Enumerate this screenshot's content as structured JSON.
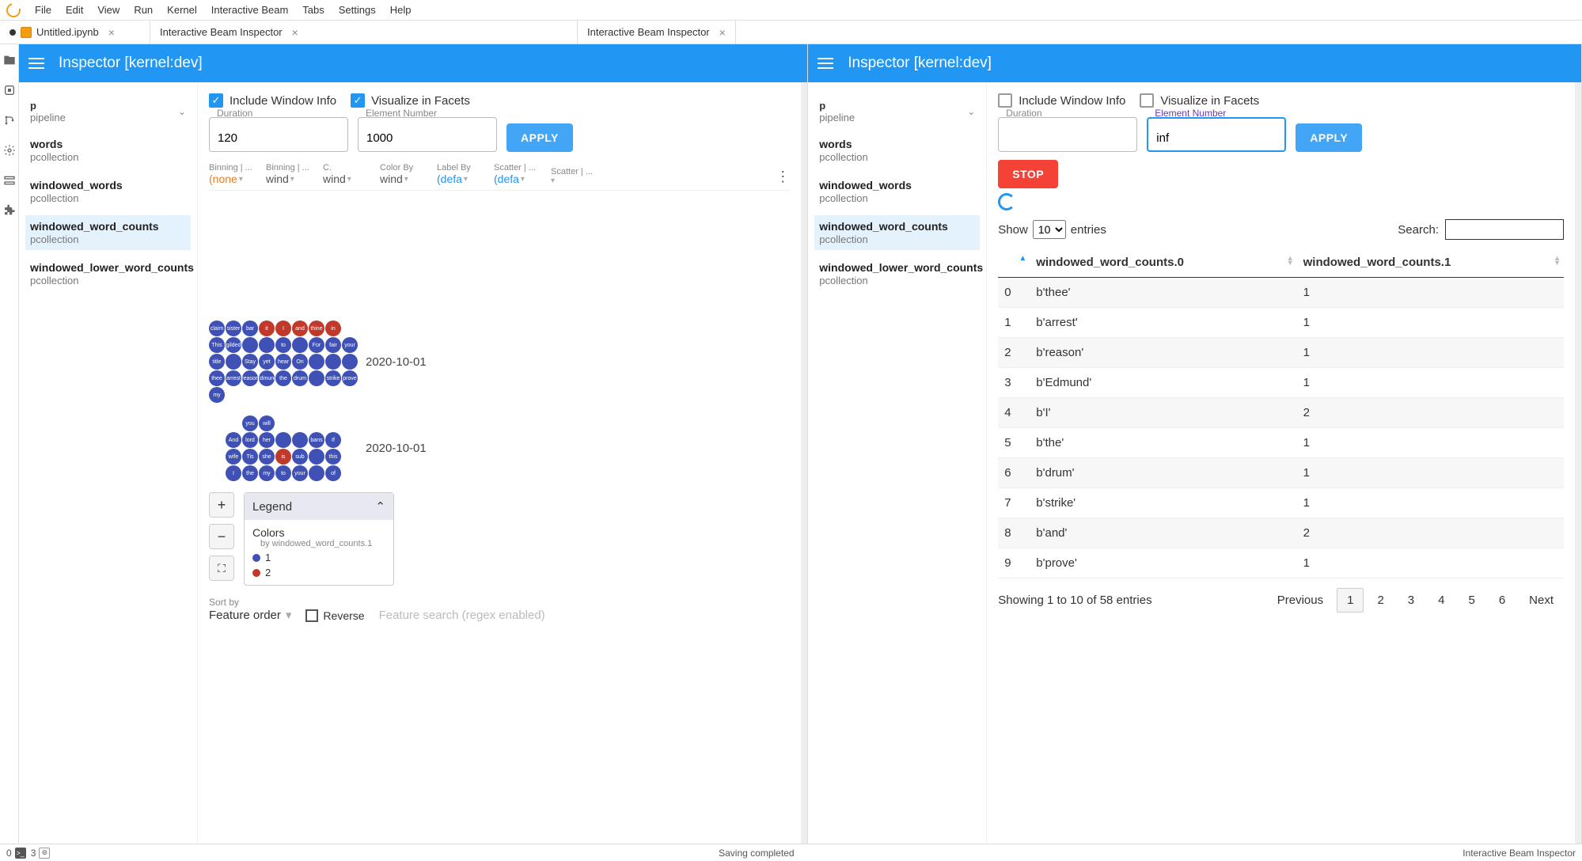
{
  "menubar": [
    "File",
    "Edit",
    "View",
    "Run",
    "Kernel",
    "Interactive Beam",
    "Tabs",
    "Settings",
    "Help"
  ],
  "tabs": [
    {
      "label": "Untitled.ipynb",
      "closable": true,
      "dirty": true,
      "icon": "notebook"
    },
    {
      "label": "Interactive Beam Inspector",
      "closable": true,
      "dirty": false
    },
    {
      "label": "Interactive Beam Inspector",
      "closable": true,
      "dirty": false
    }
  ],
  "inspector_title": "Inspector [kernel:dev]",
  "left": {
    "sidebar": {
      "p": {
        "name": "p",
        "type": "pipeline"
      },
      "items": [
        {
          "name": "words",
          "type": "pcollection",
          "selected": false
        },
        {
          "name": "windowed_words",
          "type": "pcollection",
          "selected": false
        },
        {
          "name": "windowed_word_counts",
          "type": "pcollection",
          "selected": true
        },
        {
          "name": "windowed_lower_word_counts",
          "type": "pcollection",
          "selected": false
        }
      ]
    },
    "checkboxes": {
      "include_window": "Include Window Info",
      "visualize_facets": "Visualize in Facets",
      "include_checked": true,
      "visualize_checked": true
    },
    "fields": {
      "duration_label": "Duration",
      "duration_value": "120",
      "element_label": "Element Number",
      "element_value": "1000"
    },
    "apply_label": "APPLY",
    "facets": [
      {
        "label": "Binning | ...",
        "value": "(none",
        "cls": "orange"
      },
      {
        "label": "Binning | ...",
        "value": "wind",
        "cls": ""
      },
      {
        "label": "C.",
        "value": "wind",
        "cls": ""
      },
      {
        "label": "Color By",
        "value": "wind",
        "cls": ""
      },
      {
        "label": "Label By",
        "value": "(defa",
        "cls": "blue"
      },
      {
        "label": "Scatter | ...",
        "value": "(defa",
        "cls": "blue"
      },
      {
        "label": "Scatter | ...",
        "value": "",
        "cls": ""
      }
    ],
    "cluster1_date": "2020-10-01",
    "cluster2_date": "2020-10-01",
    "cluster1": [
      {
        "t": "claim",
        "c": 1
      },
      {
        "t": "sister",
        "c": 1
      },
      {
        "t": "bar",
        "c": 1
      },
      {
        "t": "it",
        "c": 2
      },
      {
        "t": "I",
        "c": 2
      },
      {
        "t": "and",
        "c": 2
      },
      {
        "t": "thine",
        "c": 2
      },
      {
        "t": "in",
        "c": 2
      },
      {
        "t": "",
        "c": 0
      },
      {
        "t": "This",
        "c": 1
      },
      {
        "t": "gilded",
        "c": 1
      },
      {
        "t": "",
        "c": 1
      },
      {
        "t": "",
        "c": 1
      },
      {
        "t": "to",
        "c": 1
      },
      {
        "t": "",
        "c": 1
      },
      {
        "t": "For",
        "c": 1
      },
      {
        "t": "fair",
        "c": 1
      },
      {
        "t": "your",
        "c": 1
      },
      {
        "t": "title",
        "c": 1
      },
      {
        "t": "",
        "c": 1
      },
      {
        "t": "Stay",
        "c": 1
      },
      {
        "t": "yet",
        "c": 1
      },
      {
        "t": "hear",
        "c": 1
      },
      {
        "t": "On",
        "c": 1
      },
      {
        "t": "",
        "c": 1
      },
      {
        "t": "",
        "c": 1
      },
      {
        "t": "",
        "c": 1
      },
      {
        "t": "thee",
        "c": 1
      },
      {
        "t": "arrest",
        "c": 1
      },
      {
        "t": "reason",
        "c": 1
      },
      {
        "t": "Edmund",
        "c": 1
      },
      {
        "t": "the",
        "c": 1
      },
      {
        "t": "drum",
        "c": 1
      },
      {
        "t": "",
        "c": 1
      },
      {
        "t": "strike",
        "c": 1
      },
      {
        "t": "prove",
        "c": 1
      },
      {
        "t": "my",
        "c": 1
      }
    ],
    "cluster2": [
      {
        "t": "",
        "c": 0
      },
      {
        "t": "",
        "c": 0
      },
      {
        "t": "you",
        "c": 1
      },
      {
        "t": "will",
        "c": 1
      },
      {
        "t": "",
        "c": 0
      },
      {
        "t": "",
        "c": 0
      },
      {
        "t": "",
        "c": 0
      },
      {
        "t": "",
        "c": 0
      },
      {
        "t": "",
        "c": 0
      },
      {
        "t": "",
        "c": 0
      },
      {
        "t": "And",
        "c": 1
      },
      {
        "t": "lord",
        "c": 1
      },
      {
        "t": "her",
        "c": 1
      },
      {
        "t": "",
        "c": 1
      },
      {
        "t": "",
        "c": 1
      },
      {
        "t": "bans",
        "c": 1
      },
      {
        "t": "If",
        "c": 1
      },
      {
        "t": "",
        "c": 0
      },
      {
        "t": "",
        "c": 0
      },
      {
        "t": "wife",
        "c": 1
      },
      {
        "t": "Tis",
        "c": 1
      },
      {
        "t": "she",
        "c": 1
      },
      {
        "t": "is",
        "c": 2
      },
      {
        "t": "sub",
        "c": 1
      },
      {
        "t": "",
        "c": 1
      },
      {
        "t": "this",
        "c": 1
      },
      {
        "t": "",
        "c": 0
      },
      {
        "t": "",
        "c": 0
      },
      {
        "t": "I",
        "c": 1
      },
      {
        "t": "the",
        "c": 1
      },
      {
        "t": "my",
        "c": 1
      },
      {
        "t": "to",
        "c": 1
      },
      {
        "t": "your",
        "c": 1
      },
      {
        "t": "",
        "c": 1
      },
      {
        "t": "of",
        "c": 1
      },
      {
        "t": "",
        "c": 0
      }
    ],
    "legend": {
      "title": "Legend",
      "colors_title": "Colors",
      "colors_sub": "by windowed_word_counts.1",
      "items": [
        {
          "label": "1",
          "color": "#3f51b5"
        },
        {
          "label": "2",
          "color": "#c0392b"
        }
      ]
    },
    "sort": {
      "label": "Sort by",
      "value": "Feature order",
      "reverse_label": "Reverse",
      "search_placeholder": "Feature search (regex enabled)"
    }
  },
  "right": {
    "sidebar": {
      "p": {
        "name": "p",
        "type": "pipeline"
      },
      "items": [
        {
          "name": "words",
          "type": "pcollection",
          "selected": false
        },
        {
          "name": "windowed_words",
          "type": "pcollection",
          "selected": false
        },
        {
          "name": "windowed_word_counts",
          "type": "pcollection",
          "selected": true
        },
        {
          "name": "windowed_lower_word_counts",
          "type": "pcollection",
          "selected": false
        }
      ]
    },
    "checkboxes": {
      "include_window": "Include Window Info",
      "visualize_facets": "Visualize in Facets",
      "include_checked": false,
      "visualize_checked": false
    },
    "fields": {
      "duration_label": "Duration",
      "duration_value": "",
      "element_label": "Element Number",
      "element_value": "inf"
    },
    "apply_label": "APPLY",
    "stop_label": "STOP",
    "show_prefix": "Show",
    "show_value": "10",
    "show_suffix": "entries",
    "search_label": "Search:",
    "columns": [
      "",
      "windowed_word_counts.0",
      "windowed_word_counts.1"
    ],
    "rows": [
      [
        "0",
        "b'thee'",
        "1"
      ],
      [
        "1",
        "b'arrest'",
        "1"
      ],
      [
        "2",
        "b'reason'",
        "1"
      ],
      [
        "3",
        "b'Edmund'",
        "1"
      ],
      [
        "4",
        "b'I'",
        "2"
      ],
      [
        "5",
        "b'the'",
        "1"
      ],
      [
        "6",
        "b'drum'",
        "1"
      ],
      [
        "7",
        "b'strike'",
        "1"
      ],
      [
        "8",
        "b'and'",
        "2"
      ],
      [
        "9",
        "b'prove'",
        "1"
      ]
    ],
    "footer_info": "Showing 1 to 10 of 58 entries",
    "pagination": {
      "prev": "Previous",
      "pages": [
        "1",
        "2",
        "3",
        "4",
        "5",
        "6"
      ],
      "next": "Next",
      "current": "1"
    }
  },
  "statusbar": {
    "left_num": "0",
    "left_num2": "3",
    "center": "Saving completed",
    "right": "Interactive Beam Inspector"
  }
}
